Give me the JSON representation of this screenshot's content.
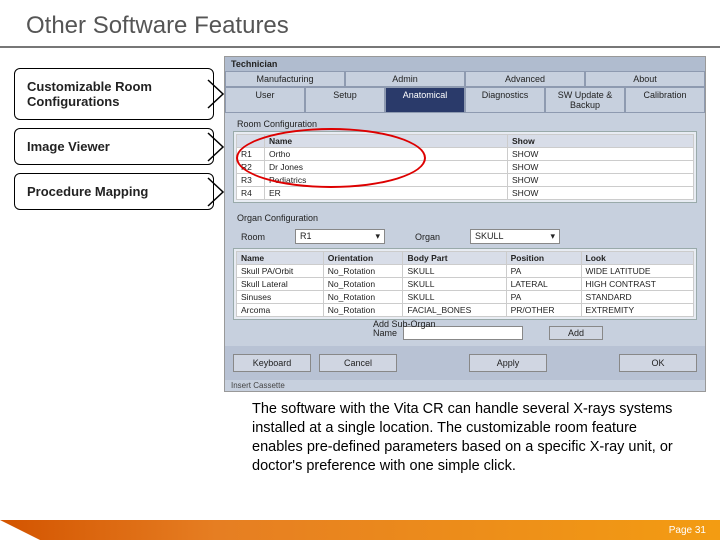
{
  "title": "Other Software Features",
  "labels": [
    "Customizable Room Configurations",
    "Image Viewer",
    "Procedure Mapping"
  ],
  "ss": {
    "topbar": "Technician",
    "tabs": [
      "Manufacturing",
      "Admin",
      "Advanced",
      "About"
    ],
    "subtabs": [
      "User",
      "Setup",
      "Anatomical",
      "Diagnostics",
      "SW Update & Backup",
      "Calibration"
    ],
    "subtabActive": 2,
    "panel1": "Room Configuration",
    "roomHead": [
      "Name",
      "Show"
    ],
    "rooms": [
      [
        "R1",
        "Ortho",
        "SHOW"
      ],
      [
        "R2",
        "Dr Jones",
        "SHOW"
      ],
      [
        "R3",
        "Pediatrics",
        "SHOW"
      ],
      [
        "R4",
        "ER",
        "SHOW"
      ]
    ],
    "panel2": "Organ Configuration",
    "dropLabels": [
      "Room",
      "Organ"
    ],
    "dropVals": [
      "R1",
      "SKULL"
    ],
    "organHead": [
      "Name",
      "Orientation",
      "Body Part",
      "Position",
      "Look"
    ],
    "organs": [
      [
        "Skull PA/Orbit",
        "No_Rotation",
        "SKULL",
        "PA",
        "WIDE LATITUDE"
      ],
      [
        "Skull Lateral",
        "No_Rotation",
        "SKULL",
        "LATERAL",
        "HIGH CONTRAST"
      ],
      [
        "Sinuses",
        "No_Rotation",
        "SKULL",
        "PA",
        "STANDARD"
      ],
      [
        "Arcoma",
        "No_Rotation",
        "FACIAL_BONES",
        "PR/OTHER",
        "EXTREMITY"
      ]
    ],
    "addLabel": "Add Sub-Organ",
    "addName": "Name",
    "addBtn": "Add",
    "buttons": [
      "Keyboard",
      "Cancel",
      "Apply",
      "OK"
    ],
    "footc": "Insert Cassette"
  },
  "caption": "The software with the Vita CR can handle several X-rays systems installed at a single location. The customizable room feature enables pre-defined parameters based on a specific X-ray unit, or doctor's preference with one simple click.",
  "page": "Page 31"
}
